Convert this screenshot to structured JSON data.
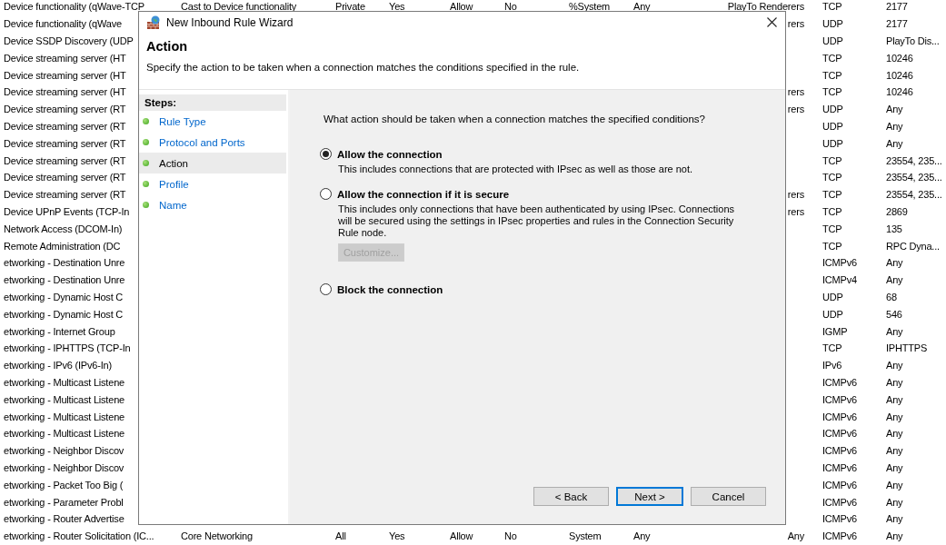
{
  "background_table": {
    "rows": [
      {
        "name": "Device functionality (qWave-TCP",
        "group": "Cast to Device functionality",
        "profile": "Private",
        "enabled": "Yes",
        "action": "Allow",
        "override": "No",
        "program": "%System",
        "local_address": "Any",
        "remote_address": "PlayTo Renderers",
        "protocol": "TCP",
        "local_port": "2177"
      },
      {
        "name": "Device functionality (qWave",
        "remote_address": "rers",
        "protocol": "UDP",
        "local_port": "2177"
      },
      {
        "name": "Device SSDP Discovery (UDP",
        "protocol": "UDP",
        "local_port": "PlayTo Dis..."
      },
      {
        "name": "Device streaming server (HT",
        "protocol": "TCP",
        "local_port": "10246"
      },
      {
        "name": "Device streaming server (HT",
        "protocol": "TCP",
        "local_port": "10246"
      },
      {
        "name": "Device streaming server (HT",
        "remote_address": "rers",
        "protocol": "TCP",
        "local_port": "10246"
      },
      {
        "name": "Device streaming server (RT",
        "remote_address": "rers",
        "protocol": "UDP",
        "local_port": "Any"
      },
      {
        "name": "Device streaming server (RT",
        "protocol": "UDP",
        "local_port": "Any"
      },
      {
        "name": "Device streaming server (RT",
        "protocol": "UDP",
        "local_port": "Any"
      },
      {
        "name": "Device streaming server (RT",
        "protocol": "TCP",
        "local_port": "23554, 235..."
      },
      {
        "name": "Device streaming server (RT",
        "protocol": "TCP",
        "local_port": "23554, 235..."
      },
      {
        "name": "Device streaming server (RT",
        "remote_address": "rers",
        "protocol": "TCP",
        "local_port": "23554, 235..."
      },
      {
        "name": "Device UPnP Events (TCP-In",
        "remote_address": "rers",
        "protocol": "TCP",
        "local_port": "2869"
      },
      {
        "name": "Network Access (DCOM-In)",
        "protocol": "TCP",
        "local_port": "135"
      },
      {
        "name": "Remote Administration (DC",
        "protocol": "TCP",
        "local_port": "RPC Dyna..."
      },
      {
        "name": "etworking - Destination Unre",
        "protocol": "ICMPv6",
        "local_port": "Any"
      },
      {
        "name": "etworking - Destination Unre",
        "protocol": "ICMPv4",
        "local_port": "Any"
      },
      {
        "name": "etworking - Dynamic Host C",
        "protocol": "UDP",
        "local_port": "68"
      },
      {
        "name": "etworking - Dynamic Host C",
        "protocol": "UDP",
        "local_port": "546"
      },
      {
        "name": "etworking - Internet Group",
        "protocol": "IGMP",
        "local_port": "Any"
      },
      {
        "name": "etworking - IPHTTPS (TCP-In",
        "protocol": "TCP",
        "local_port": "IPHTTPS"
      },
      {
        "name": "etworking - IPv6 (IPv6-In)",
        "protocol": "IPv6",
        "local_port": "Any"
      },
      {
        "name": "etworking - Multicast Listene",
        "protocol": "ICMPv6",
        "local_port": "Any"
      },
      {
        "name": "etworking - Multicast Listene",
        "protocol": "ICMPv6",
        "local_port": "Any"
      },
      {
        "name": "etworking - Multicast Listene",
        "protocol": "ICMPv6",
        "local_port": "Any"
      },
      {
        "name": "etworking - Multicast Listene",
        "protocol": "ICMPv6",
        "local_port": "Any"
      },
      {
        "name": "etworking - Neighbor Discov",
        "protocol": "ICMPv6",
        "local_port": "Any"
      },
      {
        "name": "etworking - Neighbor Discov",
        "protocol": "ICMPv6",
        "local_port": "Any"
      },
      {
        "name": "etworking - Packet Too Big (",
        "protocol": "ICMPv6",
        "local_port": "Any"
      },
      {
        "name": "etworking - Parameter Probl",
        "protocol": "ICMPv6",
        "local_port": "Any"
      },
      {
        "name": "etworking - Router Advertise",
        "protocol": "ICMPv6",
        "local_port": "Any"
      },
      {
        "name": "etworking - Router Solicitation (IC...",
        "group": "Core Networking",
        "profile": "All",
        "enabled": "Yes",
        "action": "Allow",
        "override": "No",
        "program": "System",
        "local_address": "Any",
        "remote_address": "Any",
        "protocol": "ICMPv6",
        "local_port": "Any"
      }
    ]
  },
  "dialog": {
    "title": "New Inbound Rule Wizard",
    "heading": "Action",
    "description": "Specify the action to be taken when a connection matches the conditions specified in the rule.",
    "steps_label": "Steps:",
    "steps": [
      {
        "label": "Rule Type",
        "selected": false
      },
      {
        "label": "Protocol and Ports",
        "selected": false
      },
      {
        "label": "Action",
        "selected": true
      },
      {
        "label": "Profile",
        "selected": false
      },
      {
        "label": "Name",
        "selected": false
      }
    ],
    "question": "What action should be taken when a connection matches the specified conditions?",
    "options": [
      {
        "label": "Allow the connection",
        "selected": true,
        "description": "This includes connections that are protected with IPsec as well as those are not."
      },
      {
        "label": "Allow the connection if it is secure",
        "selected": false,
        "description": "This includes only connections that have been authenticated by using IPsec.  Connections will be secured using the settings in IPsec properties and rules in the Connection Security Rule node.",
        "button": {
          "label": "Customize...",
          "disabled": true
        }
      },
      {
        "label": "Block the connection",
        "selected": false
      }
    ],
    "buttons": [
      {
        "label": "< Back",
        "default": false
      },
      {
        "label": "Next >",
        "default": true
      },
      {
        "label": "Cancel",
        "default": false
      }
    ]
  }
}
